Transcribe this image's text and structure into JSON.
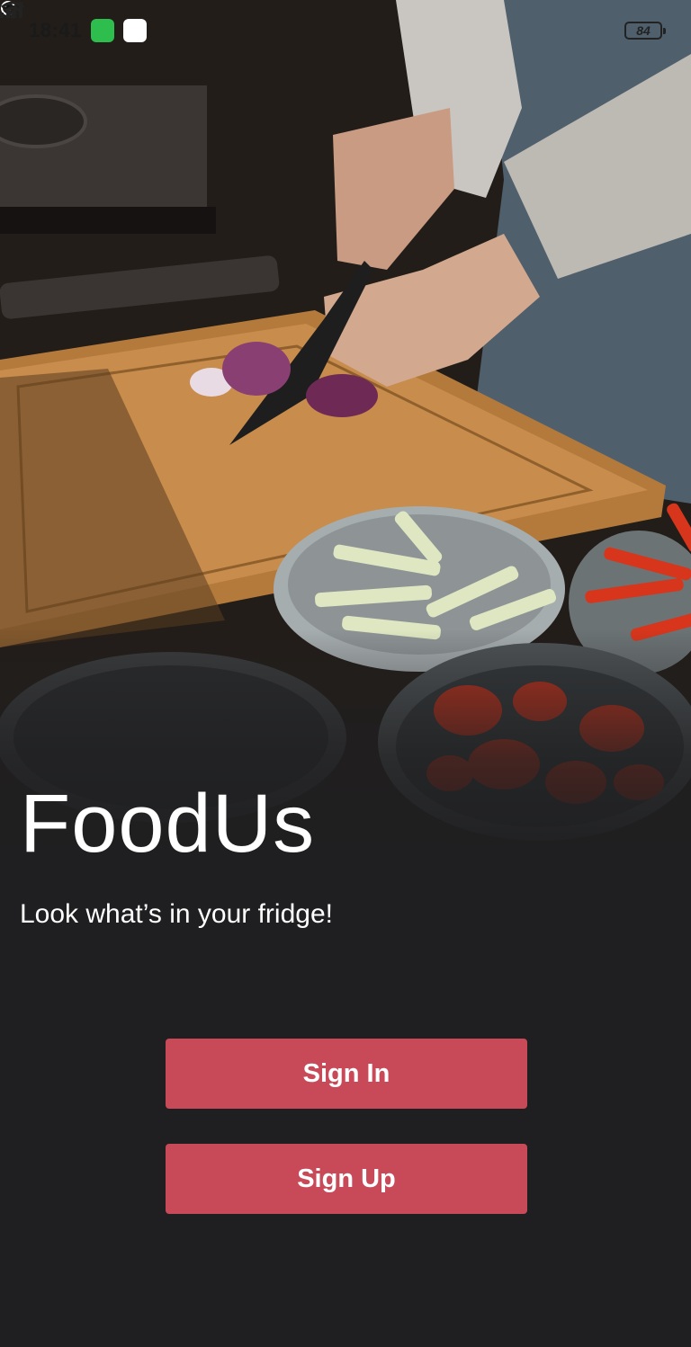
{
  "status_bar": {
    "time": "18:41",
    "battery_level": "84",
    "icons": [
      "whatsapp-icon",
      "app-wheel-icon",
      "signal-icon",
      "wifi-icon",
      "battery-icon"
    ]
  },
  "hero": {
    "image": "photo of a person slicing red onion on a wooden cutting board with bowls of cucumber, red pepper and tomato"
  },
  "app": {
    "title": "FoodUs",
    "tagline": "Look what’s in your fridge!"
  },
  "actions": {
    "sign_in_label": "Sign In",
    "sign_up_label": "Sign Up"
  },
  "colors": {
    "background": "#1f1f21",
    "primary_button": "#c84a59",
    "text": "#ffffff"
  }
}
